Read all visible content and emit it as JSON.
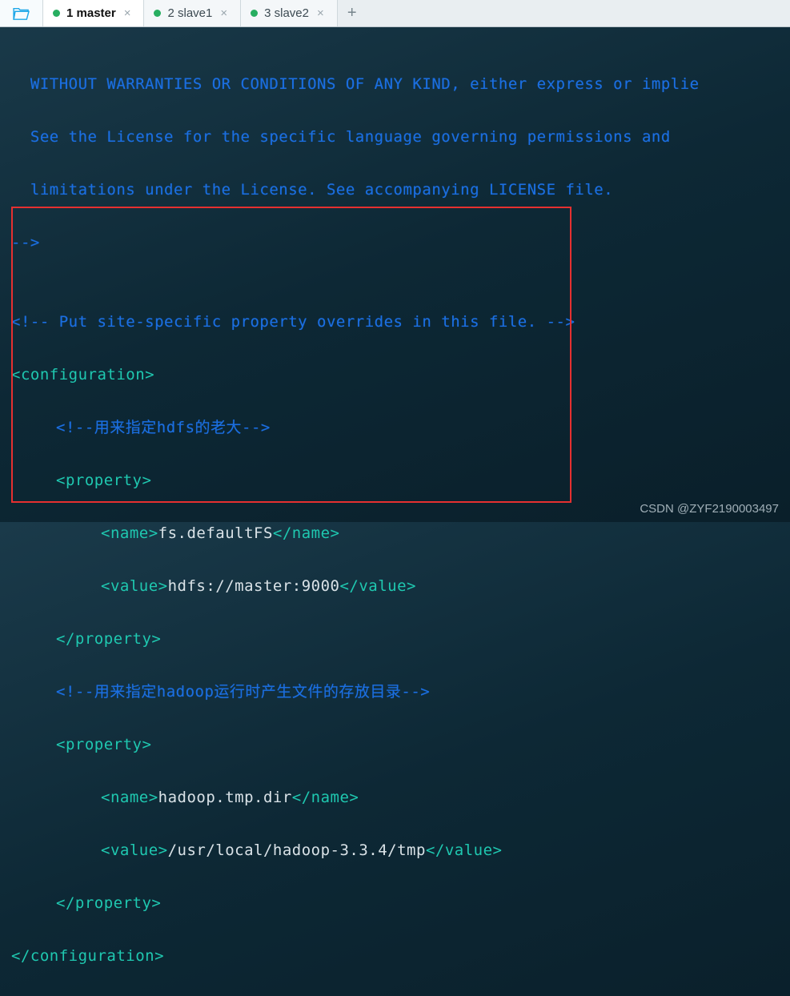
{
  "tabs": [
    {
      "label": "1 master",
      "active": true
    },
    {
      "label": "2 slave1",
      "active": false
    },
    {
      "label": "3 slave2",
      "active": false
    }
  ],
  "code": {
    "line01": "  WITHOUT WARRANTIES OR CONDITIONS OF ANY KIND, either express or implie",
    "line02": "  See the License for the specific language governing permissions and",
    "line03": "  limitations under the License. See accompanying LICENSE file.",
    "line04": "-->",
    "line05": "",
    "line06": "<!-- Put site-specific property overrides in this file. -->",
    "conf_open": "<configuration>",
    "c1": "<!--用来指定hdfs的老大-->",
    "prop_open": "<property>",
    "name_open": "<name>",
    "name1_text": "fs.defaultFS",
    "name_close": "</name>",
    "value_open": "<value>",
    "value1_text": "hdfs://master:9000",
    "value_close": "</value>",
    "prop_close": "</property>",
    "c2": "<!--用来指定hadoop运行时产生文件的存放目录-->",
    "name2_text": "hadoop.tmp.dir",
    "value2_text": "/usr/local/hadoop-3.3.4/tmp",
    "conf_close": "</configuration>"
  },
  "watermark": "CSDN @ZYF2190003497"
}
